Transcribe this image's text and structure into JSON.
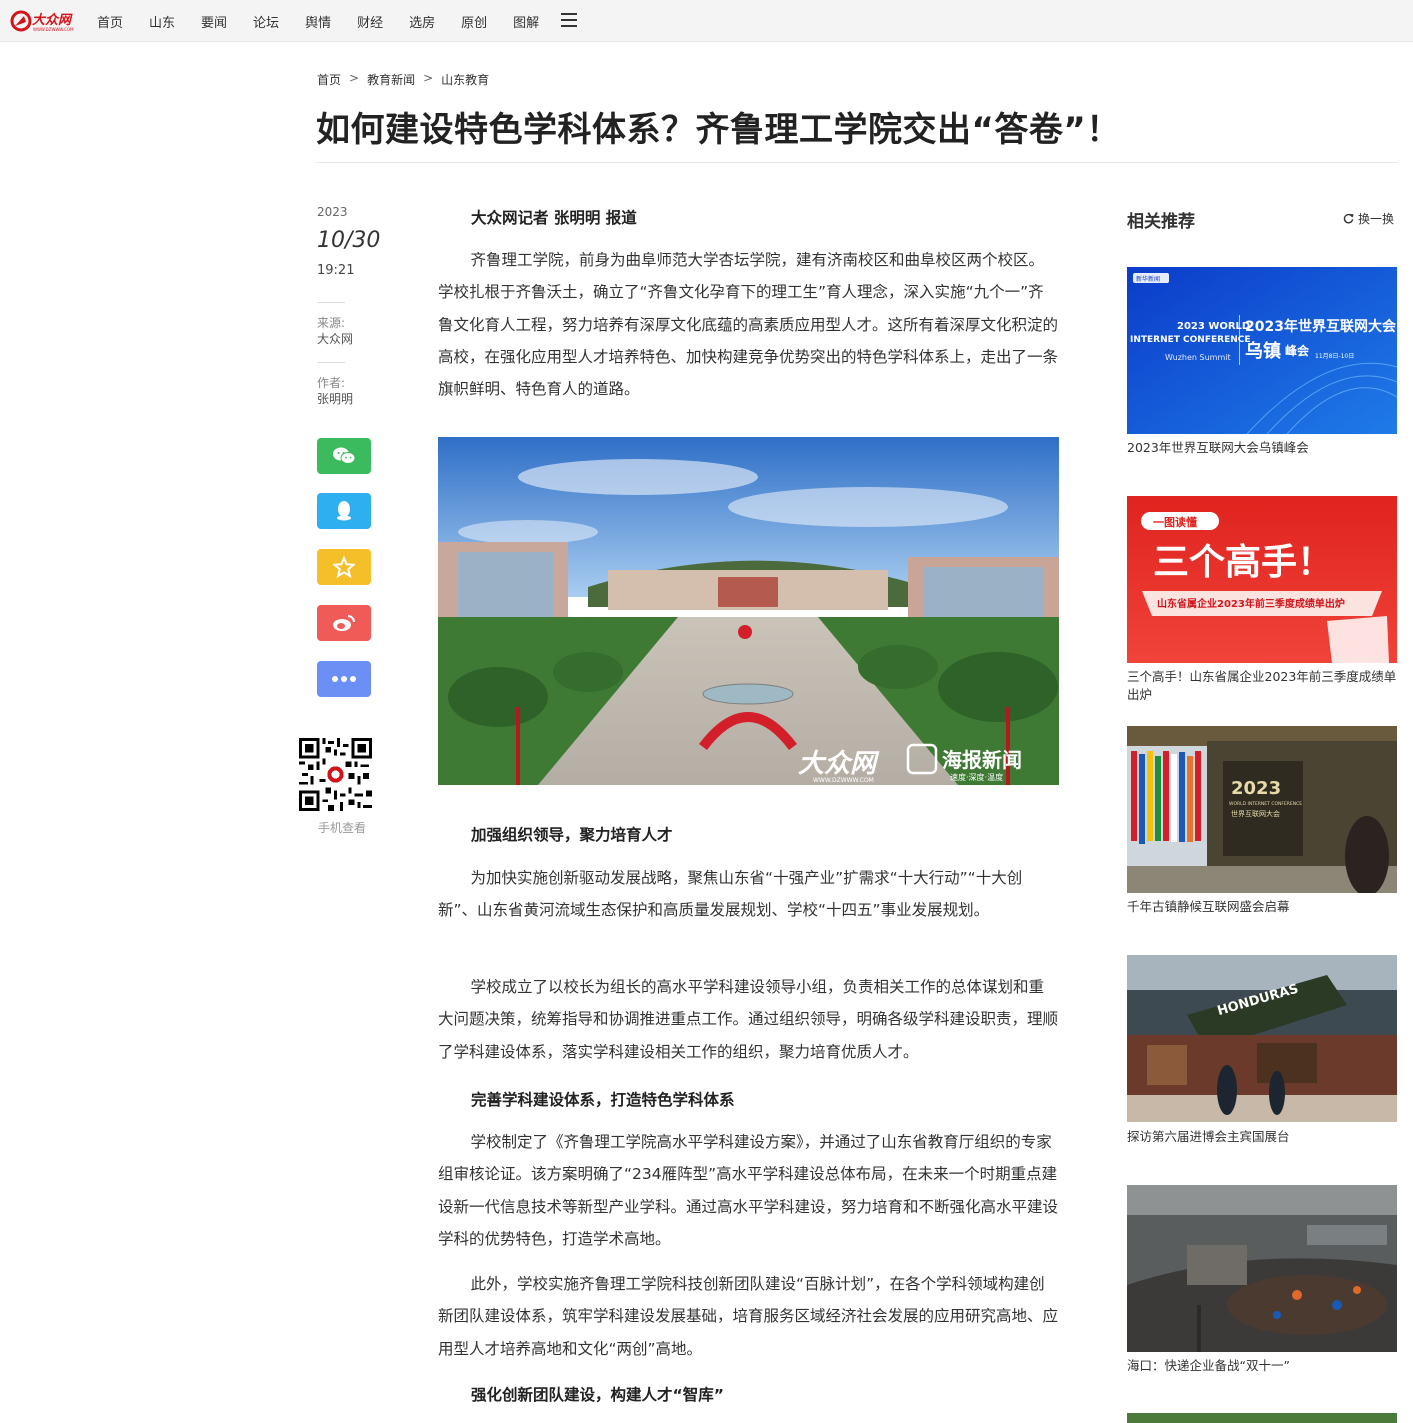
{
  "topnav": {
    "logo_text": "大众网",
    "logo_sub": "WWW.DZWWW.COM",
    "items": [
      "首页",
      "山东",
      "要闻",
      "论坛",
      "舆情",
      "财经",
      "选房",
      "原创",
      "图解"
    ],
    "menu_icon": "hamburger-icon"
  },
  "breadcrumb": [
    "首页",
    "教育新闻",
    "山东教育"
  ],
  "breadcrumb_sep": ">",
  "article": {
    "title": "如何建设特色学科体系？齐鲁理工学院交出“答卷”！",
    "year": "2023",
    "date": "10/30",
    "time": "19:21",
    "source_label": "来源:",
    "source": "大众网",
    "author_label": "作者:",
    "author": "张明明",
    "byline": "大众网记者 张明明 报道",
    "p1": "齐鲁理工学院，前身为曲阜师范大学杏坛学院，建有济南校区和曲阜校区两个校区。学校扎根于齐鲁沃土，确立了“齐鲁文化孕育下的理工生”育人理念，深入实施“九个一”齐鲁文化育人工程，努力培养有深厚文化底蕴的高素质应用型人才。这所有着深厚文化积淀的高校，在强化应用型人才培养特色、加快构建竞争优势突出的特色学科体系上，走出了一条旗帜鲜明、特色育人的道路。",
    "image_watermark_1": "大众网",
    "image_watermark_1_sub": "WWW.DZWWW.COM",
    "image_watermark_2": "海报新闻",
    "image_watermark_2_sub": "速度·深度·温度",
    "sub1": "加强组织领导，聚力培育人才",
    "p2": "为加快实施创新驱动发展战略，聚焦山东省“十强产业”扩需求“十大行动”“十大创新”、山东省黄河流域生态保护和高质量发展规划、学校“十四五”事业发展规划。",
    "p3": "学校成立了以校长为组长的高水平学科建设领导小组，负责相关工作的总体谋划和重大问题决策，统筹指导和协调推进重点工作。通过组织领导，明确各级学科建设职责，理顺了学科建设体系，落实学科建设相关工作的组织，聚力培育优质人才。",
    "sub2": "完善学科建设体系，打造特色学科体系",
    "p4": "学校制定了《齐鲁理工学院高水平学科建设方案》，并通过了山东省教育厅组织的专家组审核论证。该方案明确了“234雁阵型”高水平学科建设总体布局，在未来一个时期重点建设新一代信息技术等新型产业学科。通过高水平学科建设，努力培育和不断强化高水平建设学科的优势特色，打造学术高地。",
    "p5": "此外，学校实施齐鲁理工学院科技创新团队建设“百脉计划”，在各个学科领域构建创新团队建设体系，筑牢学科建设发展基础，培育服务区域经济社会发展的应用研究高地、应用型人才培养高地和文化“两创”高地。",
    "sub3": "强化创新团队建设，构建人才“智库”"
  },
  "share": {
    "wechat_icon": "wechat-icon",
    "qq_icon": "qq-icon",
    "qzone_icon": "star-icon",
    "weibo_icon": "weibo-icon",
    "more_icon": "more-icon",
    "qr_label": "手机查看",
    "colors": {
      "wechat": "#3cbb5e",
      "qq": "#2eb0f0",
      "qzone": "#f5bf29",
      "weibo": "#f15b57",
      "more": "#6b8ff5"
    }
  },
  "sidebar": {
    "title": "相关推荐",
    "refresh_label": "换一换",
    "items": [
      {
        "caption": "2023年世界互联网大会乌镇峰会",
        "img_text_1": "2023 WORLD",
        "img_text_2": "INTERNET CONFERENCE",
        "img_text_3": "Wuzhen Summit",
        "img_text_4": "2023年世界互联网大会",
        "img_text_5": "乌镇",
        "img_text_6": "峰会",
        "img_text_7": "11月8日-10日",
        "img_text_8": "新华新闻"
      },
      {
        "caption": "三个高手！山东省属企业2023年前三季度成绩单出炉",
        "img_text_1": "一图读懂",
        "img_text_2": "三个高手！",
        "img_text_3": "山东省属企业2023年前三季度成绩单出炉"
      },
      {
        "caption": "千年古镇静候互联网盛会启幕",
        "img_text_1": "2023",
        "img_text_2": "WORLD INTERNET CONFERENCE",
        "img_text_3": "世界互联网大会"
      },
      {
        "caption": "探访第六届进博会主宾国展台",
        "img_text_1": "HONDURAS"
      },
      {
        "caption": "海口：快递企业备战“双十一”"
      }
    ]
  }
}
